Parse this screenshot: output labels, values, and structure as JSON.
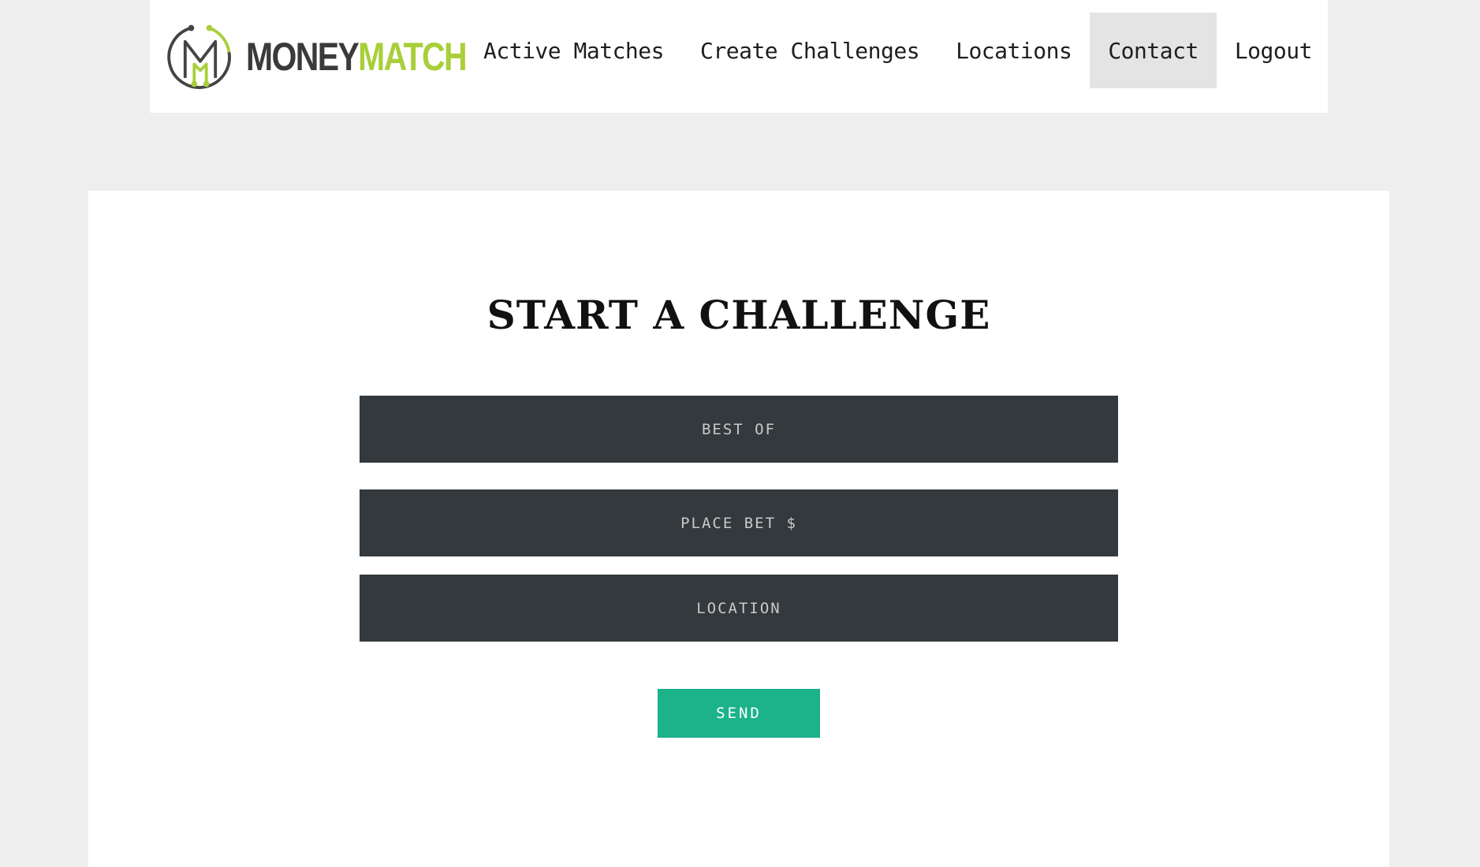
{
  "brand": {
    "name_part1": "MONEY",
    "name_part2": "MATCH",
    "icon": "moneymatch-logo-icon",
    "colors": {
      "dark": "#3a3a3a",
      "accent": "#a8cf3a"
    }
  },
  "nav": {
    "items": [
      {
        "label": "Active Matches",
        "active": false
      },
      {
        "label": "Create Challenges",
        "active": false
      },
      {
        "label": "Locations",
        "active": false
      },
      {
        "label": "Contact",
        "active": true
      },
      {
        "label": "Logout",
        "active": false
      }
    ]
  },
  "form": {
    "title": "START A CHALLENGE",
    "best_of": {
      "placeholder": "BEST OF",
      "value": ""
    },
    "bet": {
      "placeholder": "PLACE BET $",
      "value": ""
    },
    "location": {
      "placeholder": "LOCATION",
      "value": ""
    },
    "submit_label": "SEND"
  },
  "colors": {
    "page_bg": "#eeeeee",
    "field_bg": "#33393c",
    "button_bg": "#1cb28a",
    "active_nav_bg": "#e4e4e4"
  }
}
